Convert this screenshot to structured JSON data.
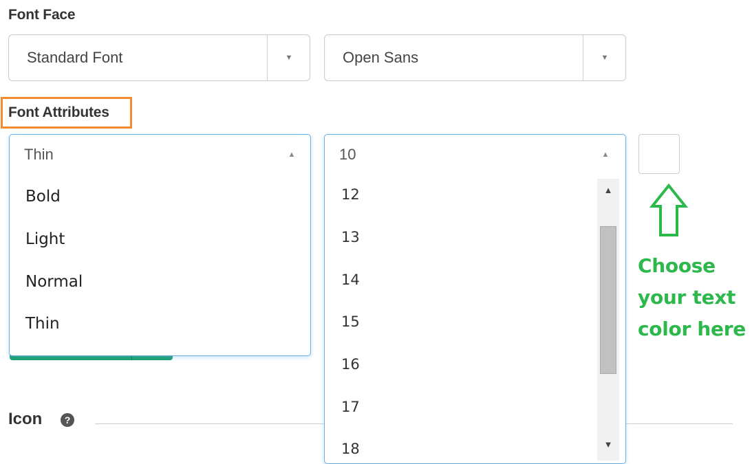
{
  "font_face": {
    "label": "Font Face",
    "type_select": {
      "value": "Standard Font"
    },
    "family_select": {
      "value": "Open Sans"
    }
  },
  "font_attributes": {
    "label": "Font Attributes",
    "weight_select": {
      "value": "Thin",
      "options": [
        "Bold",
        "Light",
        "Normal",
        "Thin"
      ]
    },
    "size_select": {
      "value": "10",
      "options": [
        "12",
        "13",
        "14",
        "15",
        "16",
        "17",
        "18"
      ]
    }
  },
  "annotation": {
    "text_line1": "Choose",
    "text_line2": "your text",
    "text_line3": "color here",
    "color": "#2db84b",
    "highlight_color": "#f28a30"
  },
  "icon_section": {
    "label": "Icon",
    "help_glyph": "?"
  },
  "colors": {
    "focus_border": "#66afe9",
    "button_green": "#1aa06d"
  }
}
